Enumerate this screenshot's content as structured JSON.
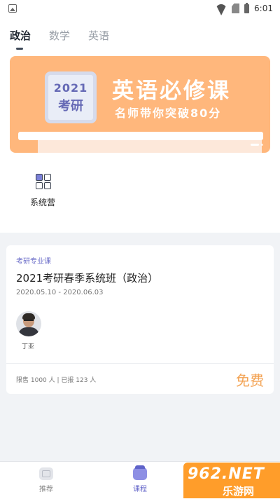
{
  "status_bar": {
    "time": "6:01"
  },
  "tabs": [
    {
      "label": "政治",
      "active": true
    },
    {
      "label": "数学",
      "active": false
    },
    {
      "label": "英语",
      "active": false
    }
  ],
  "banner": {
    "badge_year": "2021",
    "badge_word": "考研",
    "title": "英语必修课",
    "subtitle": "名师带你突破80分",
    "background_color": "#ffb77c"
  },
  "entry": {
    "label": "系统营",
    "icon": "grid-icon"
  },
  "course_card": {
    "tag": "考研专业课",
    "title": "2021考研春季系统班（政治）",
    "dates": "2020.05.10 - 2020.06.03",
    "teacher_name": "丁亚",
    "stats": "限售 1000 人 | 已报 123 人",
    "price": "免费",
    "price_color": "#f3a354"
  },
  "bottom_nav": [
    {
      "label": "推荐",
      "icon": "recommend-icon",
      "active": false
    },
    {
      "label": "课程",
      "icon": "course-icon",
      "active": true
    }
  ],
  "watermark": {
    "line1": "962.NET",
    "line2": "乐游网"
  },
  "colors": {
    "accent": "#6466c9",
    "background": "#f1f3f6"
  }
}
